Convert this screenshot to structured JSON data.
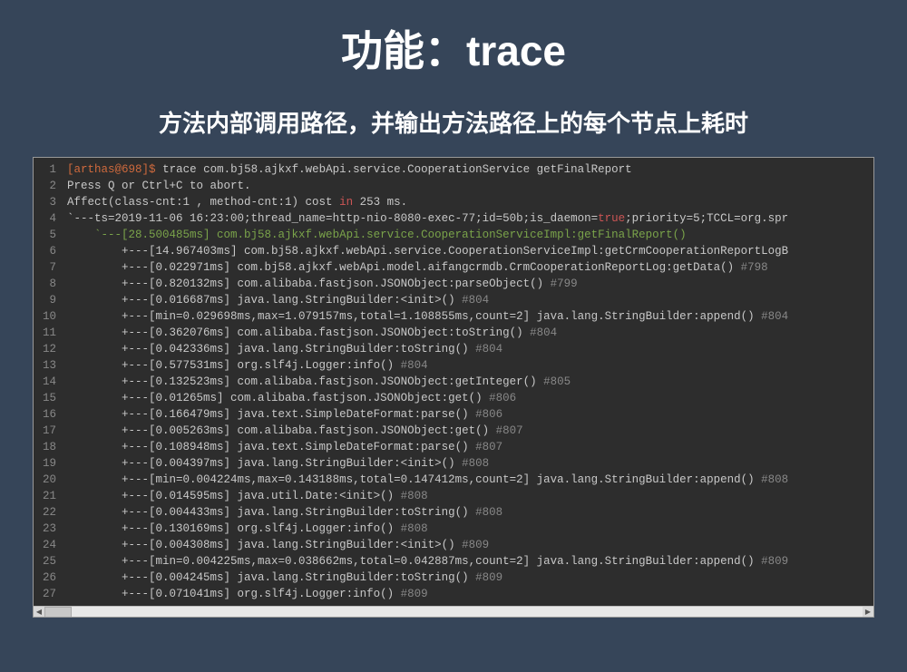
{
  "slide": {
    "title": "功能：trace",
    "subtitle": "方法内部调用路径，并输出方法路径上的每个节点上耗时"
  },
  "terminal": {
    "prompt": "[arthas@698]$",
    "command": "trace com.bj58.ajkxf.webApi.service.CooperationService getFinalReport",
    "line2": "Press Q or Ctrl+C to abort.",
    "line3_prefix": "Affect(class-cnt:1 , method-cnt:1) cost ",
    "line3_in": "in",
    "line3_suffix": " 253 ms.",
    "line4_prefix": "`---ts=2019-11-06 16:23:00;thread_name=http-nio-8080-exec-77;id=50b;is_daemon=",
    "line4_true": "true",
    "line4_suffix": ";priority=5;TCCL=org.spr",
    "line5": "    `---[28.500485ms] com.bj58.ajkxf.webApi.service.CooperationServiceImpl:getFinalReport()",
    "line6": "        +---[14.967403ms] com.bj58.ajkxf.webApi.service.CooperationServiceImpl:getCrmCooperationReportLogB",
    "rows": [
      {
        "tree": "        +---[0.022971ms] com.bj58.ajkxf.webApi.model.aifangcrmdb.CrmCooperationReportLog:getData()",
        "tag": "#798"
      },
      {
        "tree": "        +---[0.820132ms] com.alibaba.fastjson.JSONObject:parseObject()",
        "tag": "#799"
      },
      {
        "tree": "        +---[0.016687ms] java.lang.StringBuilder:<init>()",
        "tag": "#804"
      },
      {
        "tree": "        +---[min=0.029698ms,max=1.079157ms,total=1.108855ms,count=2] java.lang.StringBuilder:append()",
        "tag": "#804"
      },
      {
        "tree": "        +---[0.362076ms] com.alibaba.fastjson.JSONObject:toString()",
        "tag": "#804"
      },
      {
        "tree": "        +---[0.042336ms] java.lang.StringBuilder:toString()",
        "tag": "#804"
      },
      {
        "tree": "        +---[0.577531ms] org.slf4j.Logger:info()",
        "tag": "#804"
      },
      {
        "tree": "        +---[0.132523ms] com.alibaba.fastjson.JSONObject:getInteger()",
        "tag": "#805"
      },
      {
        "tree": "        +---[0.01265ms] com.alibaba.fastjson.JSONObject:get()",
        "tag": "#806"
      },
      {
        "tree": "        +---[0.166479ms] java.text.SimpleDateFormat:parse()",
        "tag": "#806"
      },
      {
        "tree": "        +---[0.005263ms] com.alibaba.fastjson.JSONObject:get()",
        "tag": "#807"
      },
      {
        "tree": "        +---[0.108948ms] java.text.SimpleDateFormat:parse()",
        "tag": "#807"
      },
      {
        "tree": "        +---[0.004397ms] java.lang.StringBuilder:<init>()",
        "tag": "#808"
      },
      {
        "tree": "        +---[min=0.004224ms,max=0.143188ms,total=0.147412ms,count=2] java.lang.StringBuilder:append()",
        "tag": "#808"
      },
      {
        "tree": "        +---[0.014595ms] java.util.Date:<init>()",
        "tag": "#808"
      },
      {
        "tree": "        +---[0.004433ms] java.lang.StringBuilder:toString()",
        "tag": "#808"
      },
      {
        "tree": "        +---[0.130169ms] org.slf4j.Logger:info()",
        "tag": "#808"
      },
      {
        "tree": "        +---[0.004308ms] java.lang.StringBuilder:<init>()",
        "tag": "#809"
      },
      {
        "tree": "        +---[min=0.004225ms,max=0.038662ms,total=0.042887ms,count=2] java.lang.StringBuilder:append()",
        "tag": "#809"
      },
      {
        "tree": "        +---[0.004245ms] java.lang.StringBuilder:toString()",
        "tag": "#809"
      },
      {
        "tree": "        +---[0.071041ms] org.slf4j.Logger:info()",
        "tag": "#809"
      }
    ]
  }
}
